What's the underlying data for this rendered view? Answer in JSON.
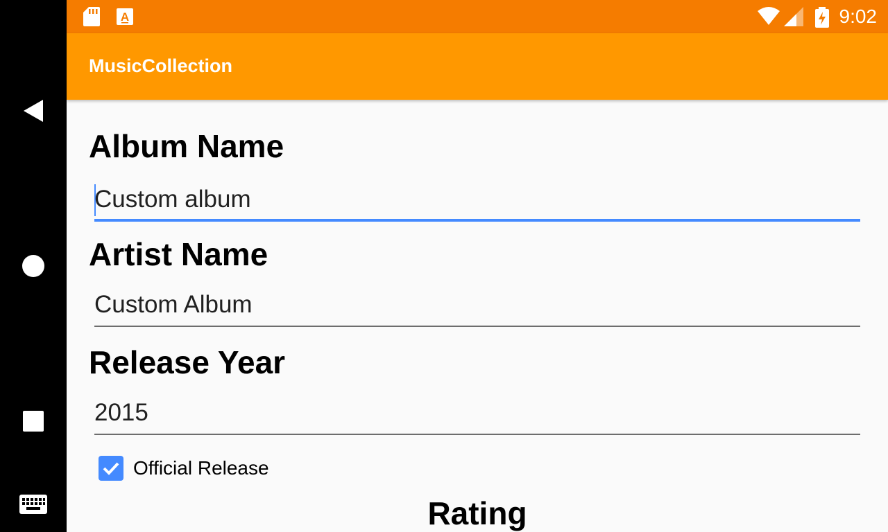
{
  "status_bar": {
    "time": "9:02",
    "icons": [
      "sd-card-icon",
      "font-a-icon",
      "wifi-icon",
      "signal-icon",
      "battery-charging-icon"
    ],
    "background": "#f57c00"
  },
  "app_bar": {
    "title": "MusicCollection",
    "background": "#ff9800"
  },
  "form": {
    "album_name": {
      "label": "Album Name",
      "value": "Custom album"
    },
    "artist_name": {
      "label": "Artist Name",
      "value": "Custom Album"
    },
    "release_year": {
      "label": "Release Year",
      "value": "2015"
    },
    "official_release": {
      "label": "Official Release",
      "checked": true
    },
    "rating": {
      "label": "Rating"
    }
  },
  "accent_color": "#448aff",
  "nav_bar": {
    "buttons": [
      "back-icon",
      "home-icon",
      "recents-icon",
      "keyboard-icon"
    ]
  }
}
